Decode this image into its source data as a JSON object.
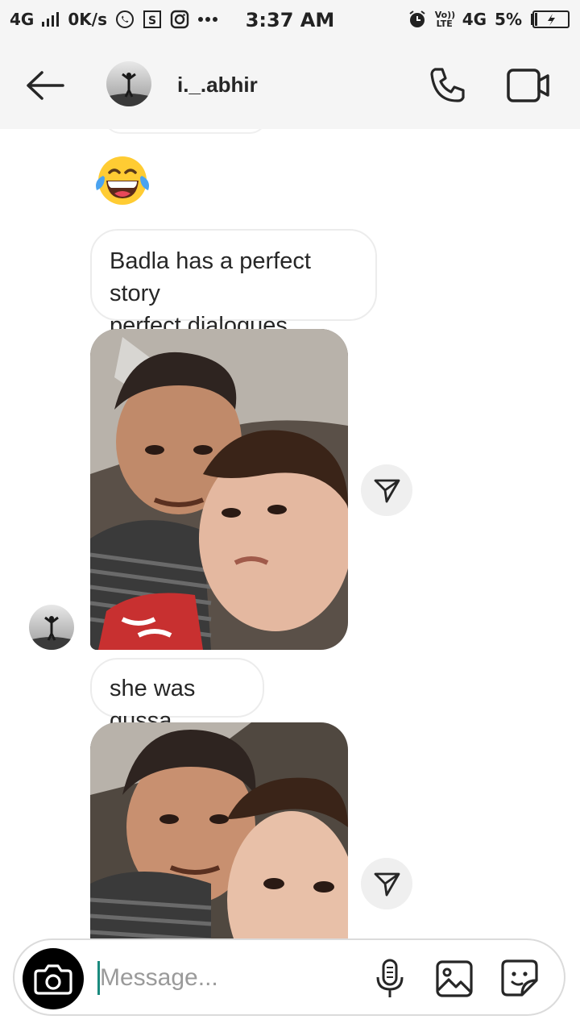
{
  "status_bar": {
    "network_left": "4G",
    "speed": "0K/s",
    "time": "3:37 AM",
    "volte": "Vo)) LTE",
    "network_right": "4G",
    "battery": "5%"
  },
  "header": {
    "username": "i._.abhir",
    "icons": [
      "back-arrow-icon",
      "phone-icon",
      "video-camera-icon"
    ]
  },
  "messages": [
    {
      "type": "emoji",
      "content": "face-with-tears-of-joy"
    },
    {
      "type": "text",
      "line1": "Badla has a perfect story",
      "line2": "perfect dialogues"
    },
    {
      "type": "photo",
      "description_icon": "selfie-photo"
    },
    {
      "type": "text",
      "line1": "she was gussa"
    },
    {
      "type": "photo",
      "description_icon": "selfie-photo"
    }
  ],
  "composer": {
    "placeholder": "Message...",
    "icons": [
      "camera-icon",
      "microphone-icon",
      "gallery-icon",
      "sticker-icon"
    ]
  },
  "colors": {
    "header_bg": "#f5f5f5",
    "bubble_border": "#ececec",
    "cursor": "#1a8a7e"
  }
}
